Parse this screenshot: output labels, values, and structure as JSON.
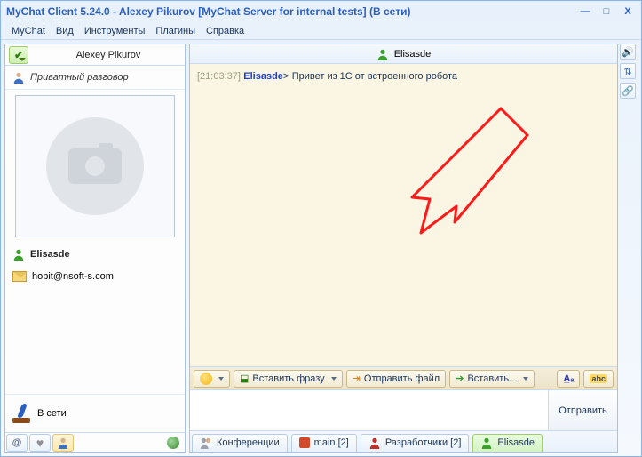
{
  "window": {
    "title": "MyChat Client 5.24.0 - Alexey Pikurov [MyChat Server for internal tests] (В сети)"
  },
  "menu": {
    "items": [
      "MyChat",
      "Вид",
      "Инструменты",
      "Плагины",
      "Справка"
    ]
  },
  "left": {
    "user_name": "Alexey Pikurov",
    "section_label": "Приватный разговор",
    "contact_name": "Elisasde",
    "contact_email": "hobit@nsoft-s.com",
    "status": "В сети"
  },
  "chat": {
    "header_name": "Elisasde",
    "message": {
      "time": "[21:03:37]",
      "from": "Elisasde",
      "sep": ">",
      "text": "Привет из 1С от встроенного робота"
    }
  },
  "toolbar": {
    "insert_phrase": "Вставить фразу",
    "send_file": "Отправить файл",
    "insert": "Вставить..."
  },
  "compose": {
    "send": "Отправить"
  },
  "tabs": {
    "conferences": "Конференции",
    "main": "main [2]",
    "developers": "Разработчики [2]",
    "active": "Elisasde"
  }
}
